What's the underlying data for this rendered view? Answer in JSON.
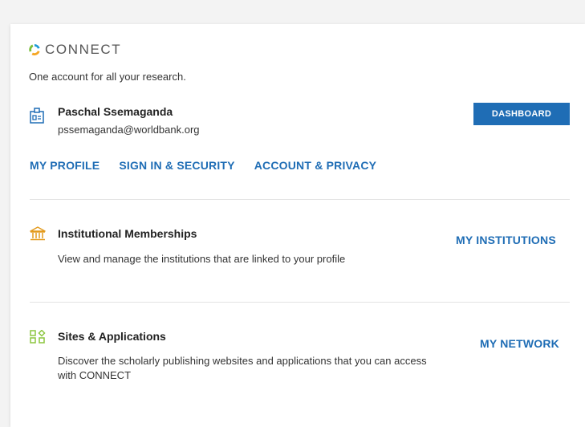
{
  "brand": {
    "name": "CONNECT",
    "tagline": "One account for all your research."
  },
  "user": {
    "name": "Paschal Ssemaganda",
    "email": "pssemaganda@worldbank.org"
  },
  "header": {
    "dashboard_label": "DASHBOARD"
  },
  "nav": {
    "links": [
      "MY PROFILE",
      "SIGN IN & SECURITY",
      "ACCOUNT & PRIVACY"
    ]
  },
  "sections": {
    "institutions": {
      "title": "Institutional Memberships",
      "description": "View and manage the institutions that are linked to your profile",
      "link": "MY INSTITUTIONS"
    },
    "sites": {
      "title": "Sites & Applications",
      "description": "Discover the scholarly publishing websites and applications that you can access with CONNECT",
      "link": "MY NETWORK"
    }
  },
  "colors": {
    "accent": "#1f6db5",
    "logo_green": "#7bbf3c",
    "logo_blue": "#1d9ad6",
    "logo_orange": "#f5a623",
    "institution_icon": "#e39a1d",
    "sites_icon": "#8cc63f"
  },
  "icons": {
    "logo": "connect-logo-icon",
    "user": "id-badge-icon",
    "institutions": "institution-building-icon",
    "sites": "apps-grid-icon"
  }
}
